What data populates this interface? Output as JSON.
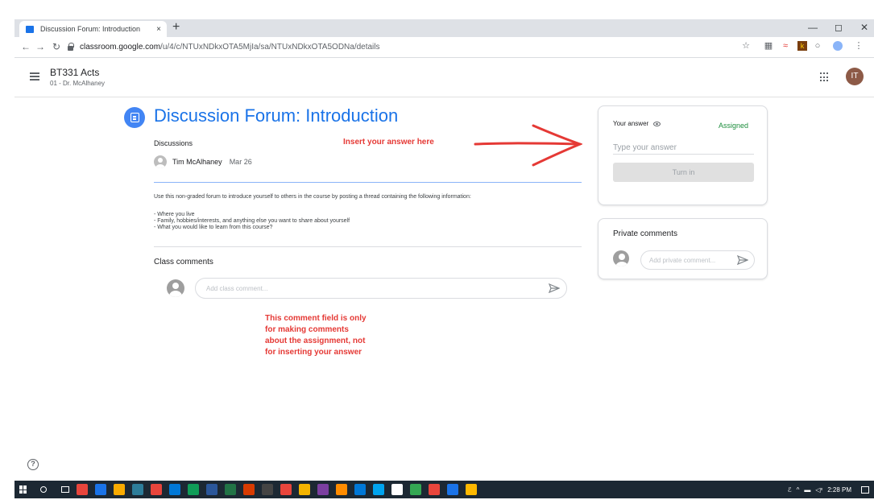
{
  "browser": {
    "tab_title": "Discussion Forum: Introduction",
    "tab_close": "×",
    "new_tab": "+",
    "url_host": "classroom.google.com",
    "url_path": "/u/4/c/NTUxNDkxOTA5MjIa/sa/NTUxNDkxOTA5ODNa/details"
  },
  "header": {
    "course_title": "BT331 Acts",
    "course_subtitle": "01 - Dr. McAlhaney",
    "avatar_initials": "IT"
  },
  "post": {
    "title": "Discussion Forum: Introduction",
    "category": "Discussions",
    "author": "Tim McAlhaney",
    "date": "Mar 26",
    "description": "Use this non-graded forum to introduce yourself to others in the course by posting a thread containing the following information:",
    "bullets": [
      "- Where you live",
      "- Family, hobbies/interests, and anything else you want to share about yourself",
      "- What you would like to learn from this course?"
    ]
  },
  "comments": {
    "heading": "Class comments",
    "placeholder": "Add class comment..."
  },
  "annotations": {
    "insert_answer": "Insert your answer here",
    "comment_note": "This comment field is only for making comments about the assignment, not for inserting your answer",
    "color": "#e53935"
  },
  "answer_card": {
    "label": "Your answer",
    "status": "Assigned",
    "input_placeholder": "Type your answer",
    "button": "Turn in"
  },
  "private_card": {
    "title": "Private comments",
    "placeholder": "Add private comment..."
  },
  "help": "?",
  "taskbar": {
    "time": "2:28 PM",
    "apps": [
      "#e8453c",
      "#1a73e8",
      "#f9ab00",
      "#2d7d9a",
      "#e8453c",
      "#0078d7",
      "#0f9d58",
      "#2b579a",
      "#217346",
      "#d83b01",
      "#444",
      "#e8453c",
      "#f4b400",
      "#7b3fa0",
      "#ff8c00",
      "#0078d7",
      "#00a4ef",
      "#fff",
      "#34a853",
      "#e8453c",
      "#1a73e8",
      "#ffb900"
    ]
  },
  "colors": {
    "accent_blue": "#1a73e8",
    "status_green": "#1e8e3e",
    "taskbar": "#1c2833"
  }
}
